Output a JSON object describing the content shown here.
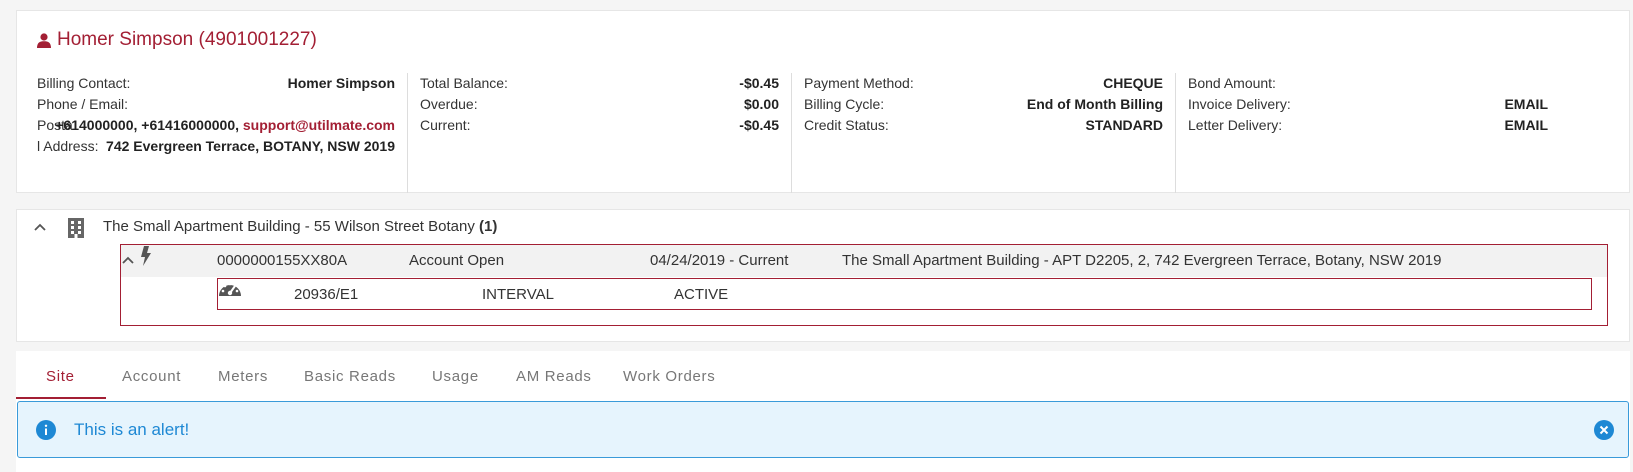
{
  "customer": {
    "name": "Homer Simpson (4901001227)",
    "billing_contact_label": "Billing Contact:",
    "billing_contact_value": "Homer Simpson",
    "phone_email_label": "Phone / Email:",
    "postal_label_1": "Posta",
    "phones": "+614000000, +61416000000,",
    "email": "support@utilmate.com",
    "postal_label_2": "l Address:",
    "postal_address": "742 Evergreen Terrace, BOTANY, NSW 2019",
    "total_balance_label": "Total Balance:",
    "total_balance_value": "-$0.45",
    "overdue_label": "Overdue:",
    "overdue_value": "$0.00",
    "current_label": "Current:",
    "current_value": "-$0.45",
    "payment_method_label": "Payment Method:",
    "payment_method_value": "CHEQUE",
    "billing_cycle_label": "Billing Cycle:",
    "billing_cycle_value": "End of Month Billing",
    "credit_status_label": "Credit Status:",
    "credit_status_value": "STANDARD",
    "bond_amount_label": "Bond Amount:",
    "invoice_delivery_label": "Invoice Delivery:",
    "invoice_delivery_value": "EMAIL",
    "letter_delivery_label": "Letter Delivery:",
    "letter_delivery_value": "EMAIL"
  },
  "property": {
    "title": "The Small Apartment Building - 55 Wilson Street Botany",
    "count": "(1)",
    "account": {
      "number": "0000000155XX80A",
      "status": "Account Open",
      "period": "04/24/2019 - Current",
      "address": "The Small Apartment Building - APT D2205, 2, 742 Evergreen Terrace, Botany, NSW 2019"
    },
    "meter": {
      "id": "20936/E1",
      "type": "INTERVAL",
      "status": "ACTIVE"
    }
  },
  "tabs": [
    "Site",
    "Account",
    "Meters",
    "Basic Reads",
    "Usage",
    "AM Reads",
    "Work Orders"
  ],
  "alert": {
    "message": "This is an alert!"
  },
  "colors": {
    "accent": "#a31f34",
    "alert_bg": "#e6f4fd",
    "alert_text": "#1e88d4"
  }
}
